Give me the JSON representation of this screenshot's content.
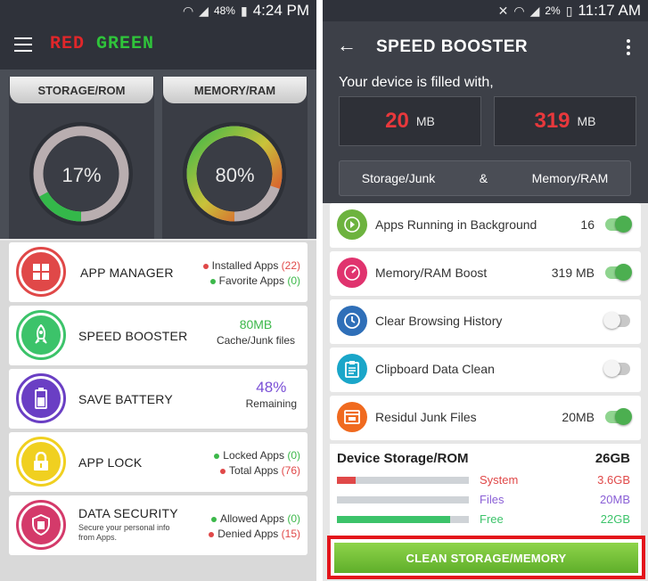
{
  "left": {
    "status": {
      "percent": "48%",
      "time": "4:24 PM"
    },
    "brand": {
      "part1": "RED",
      "part2": "GREEN"
    },
    "gauges": [
      {
        "label": "STORAGE/ROM",
        "value_text": "17%",
        "value": 17,
        "color": "#34b84a"
      },
      {
        "label": "MEMORY/RAM",
        "value_text": "80%",
        "value": 80,
        "color": "#e04a2a"
      }
    ],
    "menu": {
      "app_manager": {
        "title": "APP MANAGER",
        "line1_label": "Installed Apps",
        "line1_count": "(22)",
        "line2_label": "Favorite Apps",
        "line2_count": "(0)"
      },
      "speed_booster": {
        "title": "SPEED BOOSTER",
        "value": "80MB",
        "sub": "Cache/Junk files"
      },
      "save_battery": {
        "title": "SAVE BATTERY",
        "value": "48%",
        "sub": "Remaining"
      },
      "app_lock": {
        "title": "APP LOCK",
        "line1_label": "Locked Apps",
        "line1_count": "(0)",
        "line2_label": "Total Apps",
        "line2_count": "(76)"
      },
      "data_security": {
        "title": "DATA SECURITY",
        "sub": "Secure your personal info from Apps.",
        "line1_label": "Allowed Apps",
        "line1_count": "(0)",
        "line2_label": "Denied Apps",
        "line2_count": "(15)"
      }
    }
  },
  "right": {
    "status": {
      "percent": "2%",
      "time": "11:17 AM"
    },
    "title": "SPEED BOOSTER",
    "subtitle": "Your device is filled with,",
    "junk": {
      "value": "20",
      "unit": "MB"
    },
    "memory": {
      "value": "319",
      "unit": "MB"
    },
    "segment": {
      "left": "Storage/Junk",
      "amp": "&",
      "right": "Memory/RAM"
    },
    "rows": [
      {
        "label": "Apps Running in Background",
        "value": "16",
        "on": true,
        "color": "#6db33f",
        "icon": "play-circle-icon"
      },
      {
        "label": "Memory/RAM Boost",
        "value": "319 MB",
        "on": true,
        "color": "#e0336e",
        "icon": "gauge-icon"
      },
      {
        "label": "Clear Browsing History",
        "value": "",
        "on": false,
        "color": "#2f6fb8",
        "icon": "clock-icon"
      },
      {
        "label": "Clipboard Data Clean",
        "value": "",
        "on": false,
        "color": "#1aa6c9",
        "icon": "clipboard-icon"
      },
      {
        "label": "Residul Junk Files",
        "value": "20MB",
        "on": true,
        "color": "#f06a1f",
        "icon": "window-icon"
      }
    ],
    "storage": {
      "title": "Device Storage/ROM",
      "total": "26GB",
      "items": [
        {
          "name": "System",
          "size": "3.6GB",
          "fraction": 0.14,
          "color": "#e04848"
        },
        {
          "name": "Files",
          "size": "20MB",
          "fraction": 0.0,
          "color": "#8a5fd6"
        },
        {
          "name": "Free",
          "size": "22GB",
          "fraction": 0.86,
          "color": "#3cc36a"
        }
      ]
    },
    "clean_button": "CLEAN STORAGE/MEMORY"
  }
}
